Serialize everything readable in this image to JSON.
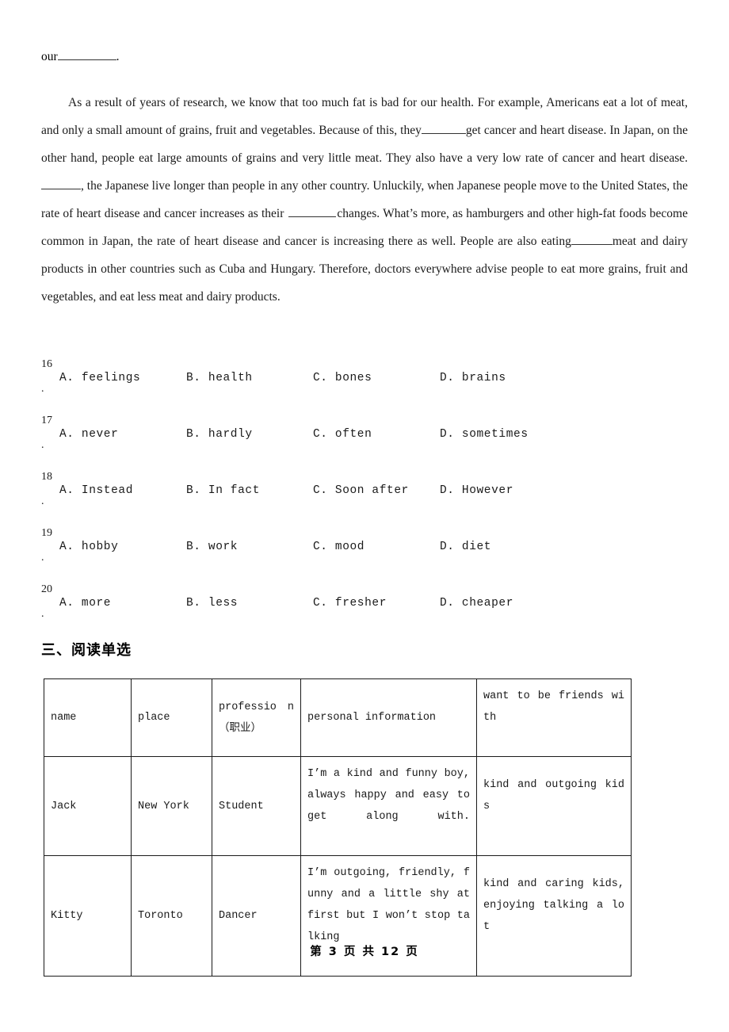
{
  "document": {
    "fragment_top": {
      "before": "our",
      "blank": "",
      "after": "."
    },
    "passage": {
      "p1_a": "As a result of years of research, we know that too much fat is bad for our health. For example, Americans eat a lot of meat, and only a small amount of grains, fruit and vegetables. Because of this, they",
      "p1_b": "get cancer and heart disease. In Japan, on the other hand, people eat large amounts of grains and very little meat. They also have a very low rate of cancer and heart disease.",
      "p1_c": ", the Japanese live longer than people in any other country. Unluckily, when Japanese people move to the United States, the rate of heart disease and cancer increases as their",
      "p1_d": "changes. What’s more, as hamburgers and other high-fat foods become common in Japan, the rate of heart disease and cancer is increasing there as well. People are also eating",
      "p1_e": "meat and dairy products in other countries such as Cuba and Hungary. Therefore, doctors everywhere advise people to eat more grains, fruit and vegetables, and eat less meat and dairy products."
    },
    "questions": [
      {
        "number": "16",
        "dot": ".",
        "options": [
          "A. feelings",
          "B. health",
          "C. bones",
          "D. brains"
        ]
      },
      {
        "number": "17",
        "dot": ".",
        "options": [
          "A. never",
          "B. hardly",
          "C. often",
          "D. sometimes"
        ]
      },
      {
        "number": "18",
        "dot": ".",
        "options": [
          "A. Instead",
          "B. In fact",
          "C. Soon after",
          "D. However"
        ]
      },
      {
        "number": "19",
        "dot": ".",
        "options": [
          "A. hobby",
          "B. work",
          "C. mood",
          "D. diet"
        ]
      },
      {
        "number": "20",
        "dot": ".",
        "options": [
          "A. more",
          "B. less",
          "C. fresher",
          "D. cheaper"
        ]
      }
    ],
    "section_heading": "三、阅读单选",
    "table": {
      "headers": [
        "name",
        "place",
        "professio n（职业）",
        "personal information",
        "want to be friends with"
      ],
      "rows": [
        {
          "name": "Jack",
          "place": "New York",
          "profession": "Student",
          "personal_information": "I’m a kind and funny boy, always happy and easy to get along with.",
          "want_to_be_friends_with": "kind and outgoing kids"
        },
        {
          "name": "Kitty",
          "place": "Toronto",
          "profession": "Dancer",
          "personal_information": "I’m outgoing, friendly, funny and a little shy at first but I won’t stop talking",
          "want_to_be_friends_with": "kind and caring kids, enjoying talking a lot"
        }
      ]
    },
    "footer": "第 3 页 共 12 页"
  }
}
